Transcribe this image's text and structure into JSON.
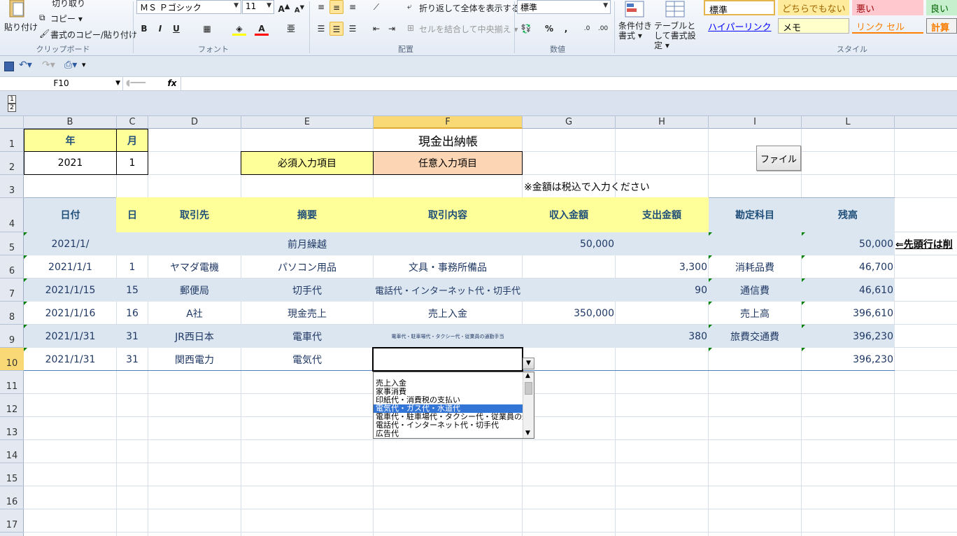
{
  "ribbon": {
    "clipboard": {
      "paste": "貼り付け",
      "cut": "切り取り",
      "copy": "コピー ▾",
      "format_painter": "書式のコピー/貼り付け",
      "label": "クリップボード"
    },
    "font": {
      "name": "ＭＳ Ｐゴシック",
      "size": "11",
      "label": "フォント",
      "bold": "B",
      "italic": "I",
      "underline": "U"
    },
    "alignment": {
      "wrap": "折り返して全体を表示する",
      "merge": "セルを結合して中央揃え ▾",
      "label": "配置"
    },
    "number": {
      "format": "標準",
      "percent": "%",
      "comma": ",",
      "label": "数値"
    },
    "styles": {
      "conditional": "条件付き書式 ▾",
      "table": "テーブルとして書式設定 ▾",
      "label": "スタイル",
      "cells": [
        "標準",
        "どちらでもない",
        "悪い",
        "良い",
        "ハイパーリンク",
        "メモ",
        "リンク セル",
        "計算"
      ]
    }
  },
  "formula_bar": {
    "name_box": "F10",
    "fx": "fx",
    "content": ""
  },
  "outline": [
    "1",
    "2"
  ],
  "columns": [
    "B",
    "C",
    "D",
    "E",
    "F",
    "G",
    "H",
    "I",
    "L"
  ],
  "selected_column": "F",
  "rows": [
    "1",
    "2",
    "3",
    "4",
    "5",
    "6",
    "7",
    "8",
    "9",
    "10",
    "11",
    "12",
    "13",
    "14",
    "15",
    "16",
    "17"
  ],
  "selected_row": "10",
  "sheet": {
    "year_label": "年",
    "month_label": "月",
    "year": "2021",
    "month": "1",
    "title": "現金出納帳",
    "required_label": "必須入力項目",
    "optional_label": "任意入力項目",
    "note": "※金額は税込で入力ください",
    "file_button": "ファイル",
    "side_note": "⇐先頭行は削",
    "headers": [
      "日付",
      "日",
      "取引先",
      "摘要",
      "取引内容",
      "収入金額",
      "支出金額",
      "勘定科目",
      "残高"
    ],
    "data": [
      [
        "2021/1/",
        "",
        "",
        "前月繰越",
        "",
        "50,000",
        "",
        "",
        "50,000"
      ],
      [
        "2021/1/1",
        "1",
        "ヤマダ電機",
        "パソコン用品",
        "文具・事務所備品",
        "",
        "3,300",
        "消耗品費",
        "46,700"
      ],
      [
        "2021/1/15",
        "15",
        "郵便局",
        "切手代",
        "電話代・インターネット代・切手代",
        "",
        "90",
        "通信費",
        "46,610"
      ],
      [
        "2021/1/16",
        "16",
        "A社",
        "現金売上",
        "売上入金",
        "350,000",
        "",
        "売上高",
        "396,610"
      ],
      [
        "2021/1/31",
        "31",
        "JR西日本",
        "電車代",
        "電車代・駐車場代・タクシー代・従業員の通勤手当",
        "",
        "380",
        "旅費交通費",
        "396,230"
      ],
      [
        "2021/1/31",
        "31",
        "関西電力",
        "電気代",
        "",
        "",
        "",
        "",
        "396,230"
      ]
    ]
  },
  "dropdown": {
    "items": [
      "売上入金",
      "家事消費",
      "印紙代・消費税の支払い",
      "電気代・ガス代・水道代",
      "電車代・駐車場代・タクシー代・従業員の通勤手当",
      "電話代・インターネット代・切手代",
      "広告代"
    ],
    "highlighted": 3
  },
  "colors": {
    "yellow": "#ffff99",
    "peach": "#fcd5b4",
    "band": "#dce6f1",
    "accent": "#1f4e79"
  }
}
